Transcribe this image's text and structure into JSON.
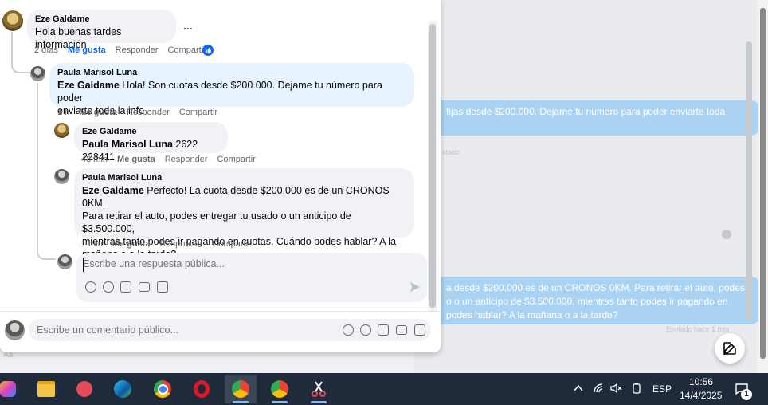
{
  "background": {
    "msg1": "fijas desde $200.000. Dejame tu número para poder enviarte toda",
    "sent_status": "stado",
    "msg2_line1": "a desde $200.000 es de un CRONOS 0KM. Para retirar el auto, podes",
    "msg2_line2": "o o un anticipo de $3.500.000, mientras tanto podes ir pagando en",
    "msg2_line3": "podes hablar? A la mañana o a la tarde?",
    "sent_time": "Enviado hace 1 min",
    "aa": "Aa"
  },
  "comments": [
    {
      "author": "Eze Galdame",
      "text": "Hola buenas tardes información",
      "time": "2 días",
      "like": "Me gusta",
      "reply": "Responder",
      "share": "Compartir",
      "more": "..."
    },
    {
      "author": "Paula Marisol Luna",
      "mention": "Eze Galdame",
      "text_line1": " Hola! Son cuotas desde $200.000. Dejame tu número para poder",
      "text_line2": "enviarte toda la info",
      "time": "1 h",
      "like": "Me gusta",
      "reply": "Responder",
      "share": "Compartir"
    },
    {
      "author": "Eze Galdame",
      "mention": "Paula Marisol Luna",
      "text": " 2622 228411",
      "time": "48 min",
      "like": "Me gusta",
      "reply": "Responder",
      "share": "Compartir"
    },
    {
      "author": "Paula Marisol Luna",
      "mention": "Eze Galdame",
      "text_line1": " Perfecto! La cuota desde $200.000 es de un CRONOS 0KM.",
      "text_line2": "Para retirar el auto, podes entregar tu usado o un anticipo de $3.500.000,",
      "text_line3": "mientras tanto podes ir pagando en cuotas. Cuándo podes hablar? A la",
      "text_line4": "mañana o a la tarde?",
      "time": "1 min",
      "like": "Me gusta",
      "reply": "Responder",
      "share": "Compartir"
    }
  ],
  "reply_box": {
    "placeholder": "Escribe una respuesta pública..."
  },
  "comment_box": {
    "placeholder": "Escribe un comentario público..."
  },
  "taskbar": {
    "language": "ESP",
    "time": "10:56",
    "date": "14/4/2025",
    "notifications": "1"
  },
  "colors": {
    "accent": "#0866ff",
    "taskbar": "#1f2b3a",
    "bubble": "#f0f2f5",
    "highlight": "#e7f3ff"
  }
}
